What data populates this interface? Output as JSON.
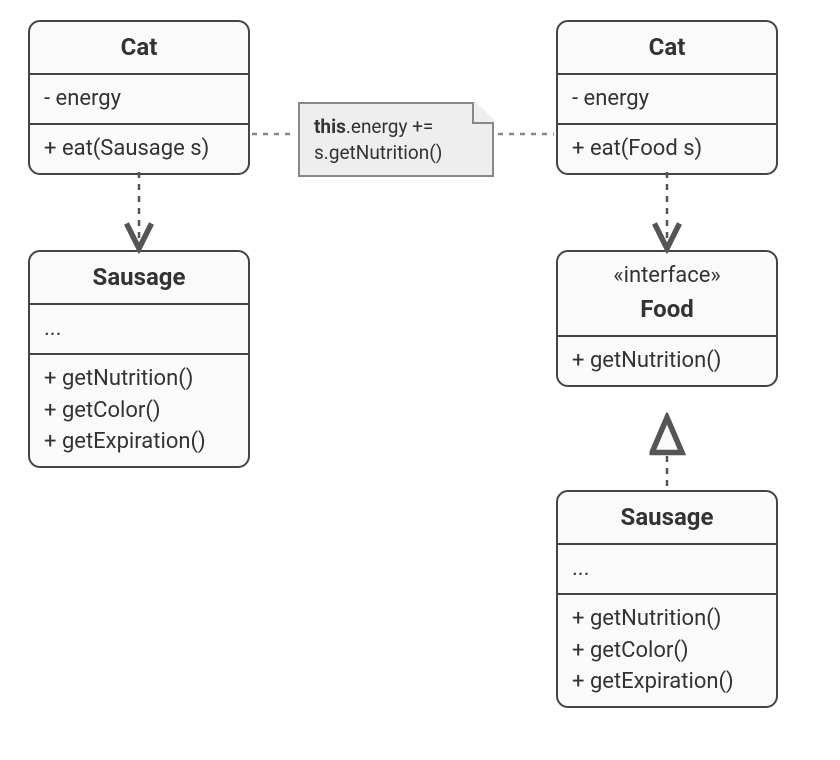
{
  "left": {
    "cat": {
      "name": "Cat",
      "attrs": "- energy",
      "ops": "+ eat(Sausage s)"
    },
    "sausage": {
      "name": "Sausage",
      "attrs": "...",
      "op1": "+ getNutrition()",
      "op2": "+ getColor()",
      "op3": "+ getExpiration()"
    }
  },
  "right": {
    "cat": {
      "name": "Cat",
      "attrs": "- energy",
      "ops": "+ eat(Food s)"
    },
    "food": {
      "stereo": "«interface»",
      "name": "Food",
      "op1": "+ getNutrition()"
    },
    "sausage": {
      "name": "Sausage",
      "attrs": "...",
      "op1": "+ getNutrition()",
      "op2": "+ getColor()",
      "op3": "+ getExpiration()"
    }
  },
  "note": {
    "prefix": "this",
    "line1_rest": ".energy +=",
    "line2": "s.getNutrition()"
  }
}
